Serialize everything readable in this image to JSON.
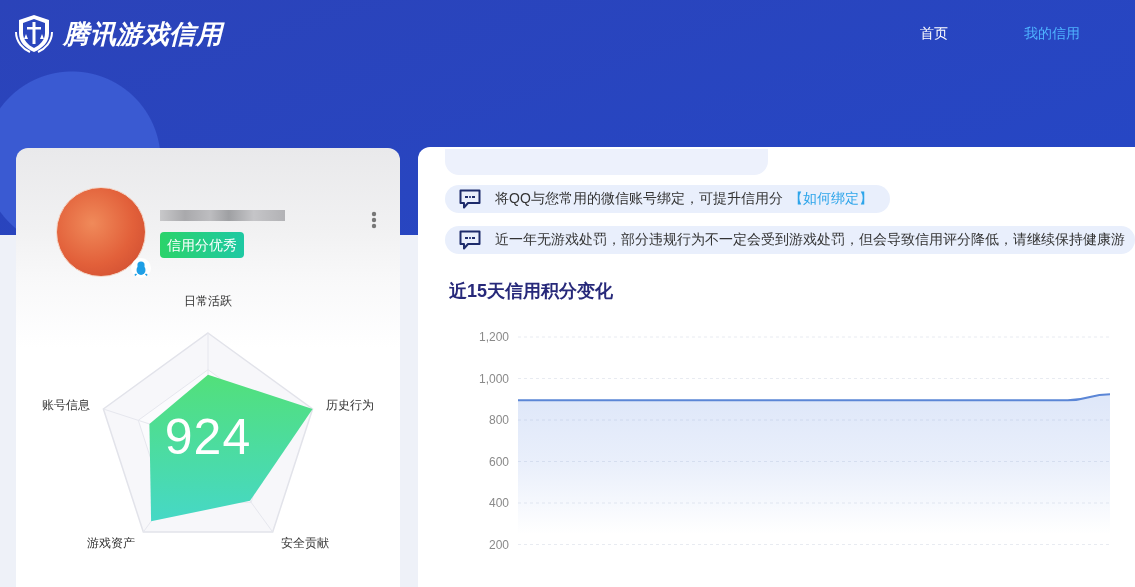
{
  "header": {
    "title": "腾讯游戏信用",
    "nav": [
      {
        "label": "首页",
        "selected": false
      },
      {
        "label": "我的信用",
        "selected": true
      }
    ]
  },
  "profile": {
    "badge": "信用分优秀",
    "score": "924",
    "radar_axes": [
      "日常活跃",
      "历史行为",
      "安全贡献",
      "游戏资产",
      "账号信息"
    ]
  },
  "notices": [
    {
      "text": "将QQ与您常用的微信账号绑定，可提升信用分",
      "link": "【如何绑定】"
    },
    {
      "text": "近一年无游戏处罚，部分违规行为不一定会受到游戏处罚，但会导致信用评分降低，请继续保持健康游"
    }
  ],
  "credit_trend": {
    "chart_data": {
      "type": "area",
      "title": "近15天信用积分变化",
      "values": [
        895,
        895,
        895,
        895,
        895,
        895,
        895,
        895,
        895,
        895,
        895,
        895,
        895,
        895,
        924
      ],
      "ylim": [
        0,
        1200
      ],
      "yticks": [
        {
          "value": 200,
          "label": "200"
        },
        {
          "value": 400,
          "label": "400"
        },
        {
          "value": 600,
          "label": "600"
        },
        {
          "value": 800,
          "label": "800"
        },
        {
          "value": 1000,
          "label": "1,000"
        },
        {
          "value": 1200,
          "label": "1,200"
        }
      ],
      "grid": true
    }
  }
}
